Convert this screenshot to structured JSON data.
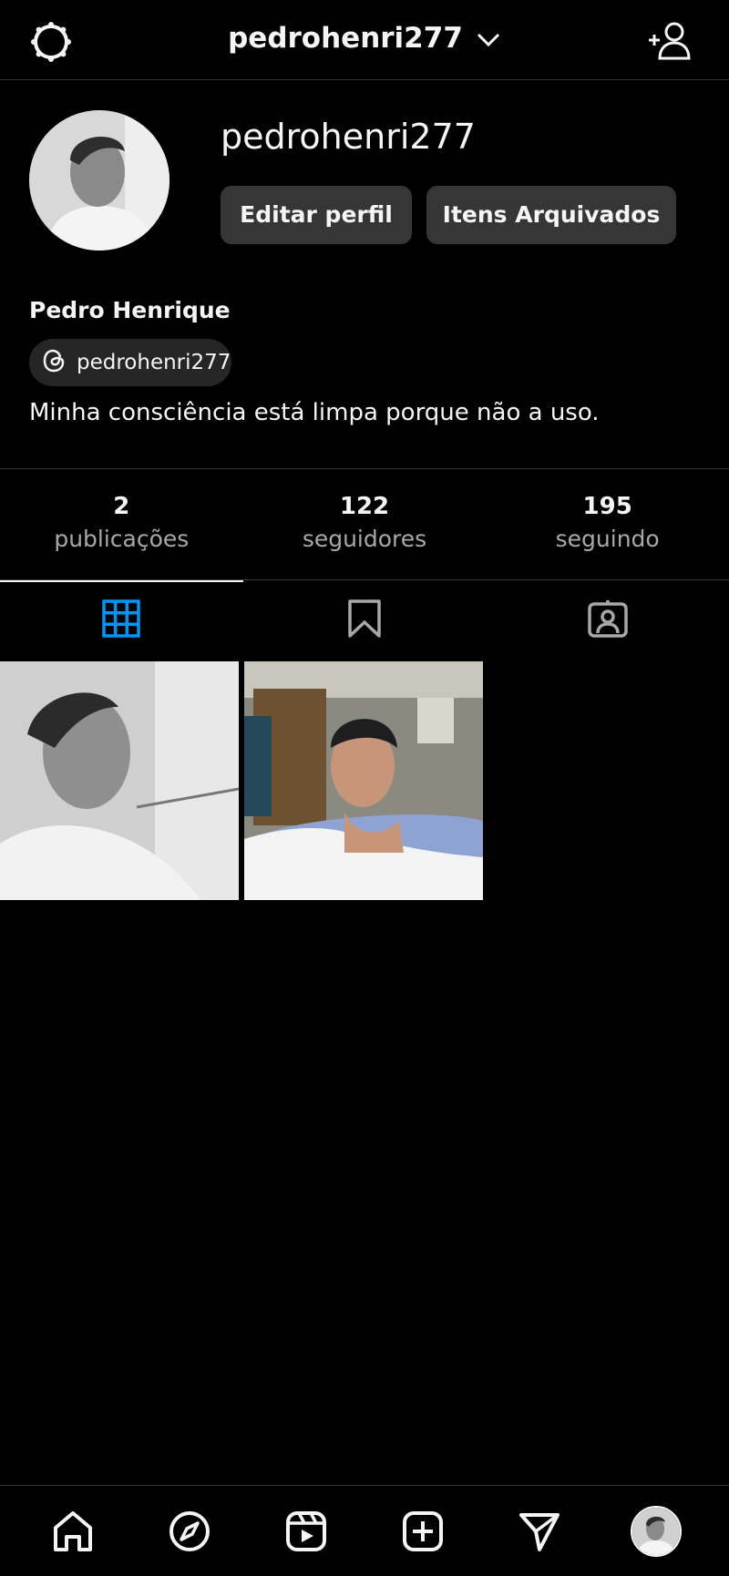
{
  "header": {
    "username": "pedrohenri277",
    "settings_icon": "settings-icon",
    "dropdown_icon": "chevron-down-icon",
    "add_user_icon": "add-user-icon"
  },
  "profile": {
    "username": "pedrohenri277",
    "edit_button": "Editar perfil",
    "archive_button": "Itens Arquivados",
    "full_name": "Pedro Henrique",
    "threads_handle": "pedrohenri277",
    "bio": "Minha consciência está limpa porque não a uso."
  },
  "stats": [
    {
      "value": "2",
      "label": "publicações"
    },
    {
      "value": "122",
      "label": "seguidores"
    },
    {
      "value": "195",
      "label": "seguindo"
    }
  ],
  "tabs": [
    {
      "icon": "grid-icon",
      "active": true
    },
    {
      "icon": "bookmark-icon",
      "active": false
    },
    {
      "icon": "tagged-icon",
      "active": false
    }
  ],
  "posts_count": 2,
  "bottom_nav": [
    "home-icon",
    "explore-icon",
    "reels-icon",
    "create-icon",
    "direct-icon",
    "profile-avatar"
  ],
  "colors": {
    "background": "#000000",
    "button": "#363636",
    "accent_active_tab": "#0095f6",
    "muted_text": "#a8a8a8"
  }
}
